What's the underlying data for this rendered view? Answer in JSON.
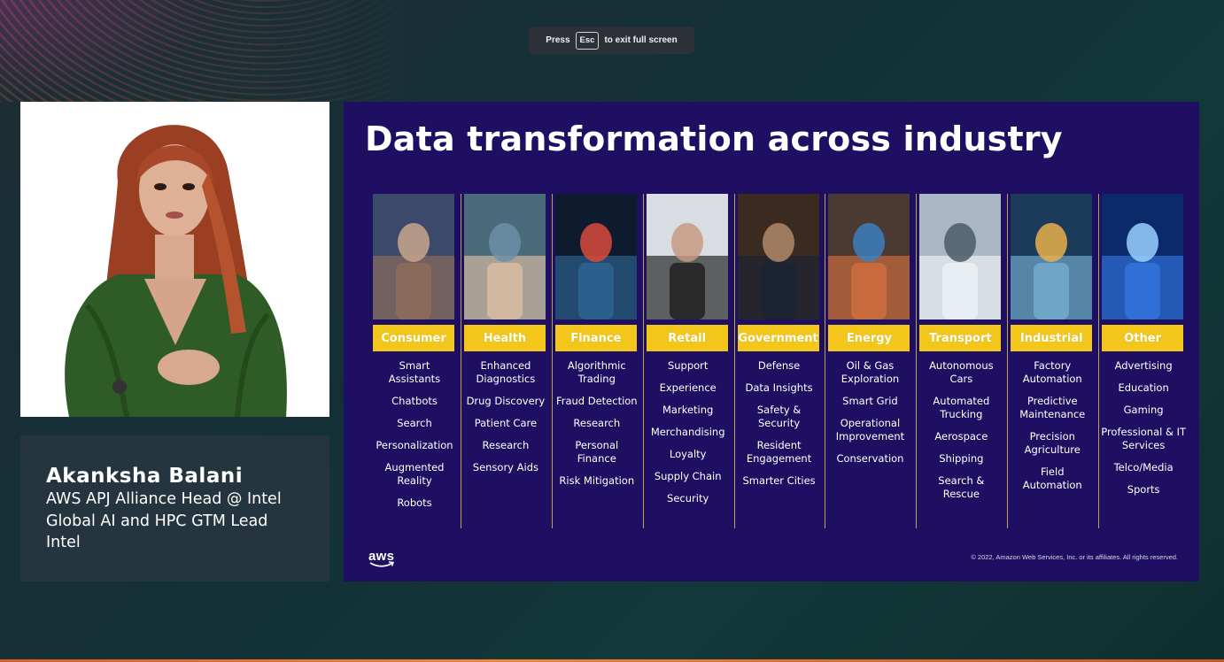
{
  "fullscreen_hint": {
    "prefix": "Press",
    "key": "Esc",
    "suffix": "to exit full screen"
  },
  "speaker": {
    "name": "Akanksha Balani",
    "title_line1": "AWS APJ Alliance Head @ Intel",
    "title_line2": "Global AI and HPC GTM Lead",
    "company": "Intel"
  },
  "slide": {
    "title": "Data transformation across industry",
    "logo_text": "aws",
    "copyright": "© 2022, Amazon Web Services, Inc. or its affiliates. All rights reserved.",
    "industries": [
      {
        "label": "Consumer",
        "items": [
          "Smart Assistants",
          "Chatbots",
          "Search",
          "Personalization",
          "Augmented Reality",
          "Robots"
        ]
      },
      {
        "label": "Health",
        "items": [
          "Enhanced Diagnostics",
          "Drug Discovery",
          "Patient Care",
          "Research",
          "Sensory Aids"
        ]
      },
      {
        "label": "Finance",
        "items": [
          "Algorithmic Trading",
          "Fraud Detection",
          "Research",
          "Personal Finance",
          "Risk Mitigation"
        ]
      },
      {
        "label": "Retail",
        "items": [
          "Support",
          "Experience",
          "Marketing",
          "Merchandising",
          "Loyalty",
          "Supply Chain",
          "Security"
        ]
      },
      {
        "label": "Government",
        "items": [
          "Defense",
          "Data Insights",
          "Safety & Security",
          "Resident Engagement",
          "Smarter Cities"
        ]
      },
      {
        "label": "Energy",
        "items": [
          "Oil & Gas Exploration",
          "Smart Grid",
          "Operational Improvement",
          "Conservation"
        ]
      },
      {
        "label": "Transport",
        "items": [
          "Autonomous Cars",
          "Automated Trucking",
          "Aerospace",
          "Shipping",
          "Search & Rescue"
        ]
      },
      {
        "label": "Industrial",
        "items": [
          "Factory Automation",
          "Predictive Maintenance",
          "Precision Agriculture",
          "Field Automation"
        ]
      },
      {
        "label": "Other",
        "items": [
          "Advertising",
          "Education",
          "Gaming",
          "Professional & IT Services",
          "Telco/Media",
          "Sports"
        ]
      }
    ]
  },
  "colors": {
    "slide_bg": "#1f0f62",
    "label_bg": "#f2c61b",
    "name_card_bg": "#253540"
  }
}
